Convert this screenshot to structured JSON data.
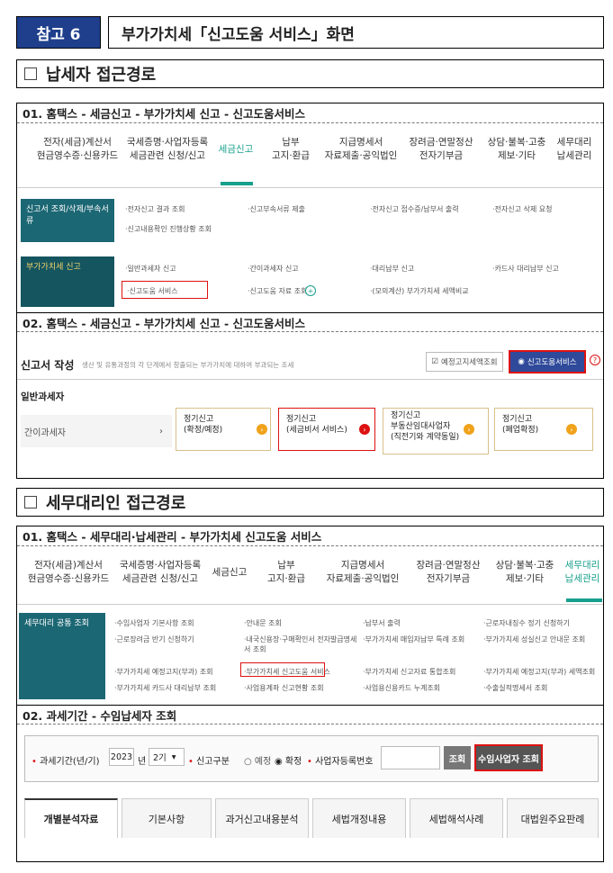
{
  "header": {
    "tag": "참고 6",
    "title": "부가가치세「신고도움 서비스」화면"
  },
  "sec1": {
    "title": "납세자 접근경로",
    "step1": "01. 홈택스 - 세금신고 - 부가가치세 신고 - 신고도움서비스",
    "nav": [
      {
        "l1": "전자(세금)계산서",
        "l2": "현금영수증·신용카드"
      },
      {
        "l1": "국세증명·사업자등록",
        "l2": "세금관련 신청/신고"
      },
      {
        "l1": "세금신고",
        "l2": ""
      },
      {
        "l1": "납부",
        "l2": "고지·환급"
      },
      {
        "l1": "지급명세서",
        "l2": "자료제출·공익법인"
      },
      {
        "l1": "장려금·연말정산",
        "l2": "전자기부금"
      },
      {
        "l1": "상담·불복·고충",
        "l2": "제보·기타"
      },
      {
        "l1": "세무대리",
        "l2": "납세관리"
      }
    ],
    "row1_label": "신고서 조회/삭제/부속서류",
    "row1_items": [
      "·전자신고 결과 조회",
      "·신고부속서류 제출",
      "·전자신고 접수증/납부서 출력",
      "·전자신고 삭제 요청",
      "·신고내용확인 진행상황 조회"
    ],
    "row2_label": "부가가치세 신고",
    "row2_items": [
      "·일반과세자 신고",
      "·간이과세자 신고",
      "·대리납부 신고",
      "·카드사 대리납부 신고",
      "·신고도움 서비스",
      "·신고도움 자료 조회",
      "·(모의계산) 부가가치세 세액비교"
    ],
    "step2": "02. 홈택스 - 세금신고 - 부가가치세 신고 - 신고도움서비스",
    "form_title": "신고서 작성",
    "form_desc": "생산 및 유통과정의 각 단계에서 창출되는 부가가치에 대하여 부과되는 조세",
    "btn_estimate": "예정고지세액조회",
    "btn_help": "신고도움서비스",
    "left_general": "일반과세자",
    "left_simple": "간이과세자",
    "cards": [
      {
        "l1": "정기신고",
        "l2": "(확정/예정)",
        "l3": ""
      },
      {
        "l1": "정기신고",
        "l2": "(세금비서 서비스)",
        "l3": ""
      },
      {
        "l1": "정기신고",
        "l2": "부동산임대사업자",
        "l3": "(직전기와 계약동일)"
      },
      {
        "l1": "정기신고",
        "l2": "(폐업확정)",
        "l3": ""
      }
    ]
  },
  "sec2": {
    "title": "세무대리인 접근경로",
    "step1": "01. 홈택스 - 세무대리·납세관리 - 부가가치세 신고도움 서비스",
    "nav": [
      {
        "l1": "전자(세금)계산서",
        "l2": "현금영수증·신용카드"
      },
      {
        "l1": "국세증명·사업자등록",
        "l2": "세금관련 신청/신고"
      },
      {
        "l1": "세금신고",
        "l2": ""
      },
      {
        "l1": "납부",
        "l2": "고지·환급"
      },
      {
        "l1": "지급명세서",
        "l2": "자료제출·공익법인"
      },
      {
        "l1": "장려금·연말정산",
        "l2": "전자기부금"
      },
      {
        "l1": "상담·불복·고충",
        "l2": "제보·기타"
      },
      {
        "l1": "세무대리",
        "l2": "납세관리"
      }
    ],
    "label": "세무대리 공통 조회",
    "items": [
      "·수임사업자 기본사항 조회",
      "·안내문 조회",
      "·납부서 출력",
      "·근로자내징수 정기 신청하기",
      "·근로장려금 반기 신청하기",
      "·내국신용장·구매확인서 전자발급명세서 조회",
      "·부가가치세 매입자납부 특례 조회",
      "·부가가치세 성실신고 안내문 조회",
      "·부가가치세 예정고지(부과) 조회",
      "·부가가치세 신고도움 서비스",
      "·부가가치세 신고자료 통합조회",
      "·부가가치세 예정고지(부과) 세액조회",
      "·부가가치세 카드사 대리납부 조회",
      "·사업용계좌 신고현황 조회",
      "·사업용신용카드 누계조회",
      "·수출실적명세서 조회"
    ],
    "step2": "02. 과세기간 - 수임납세자 조회",
    "q_period": "과세기간(년/기)",
    "q_year": "2023",
    "q_year_unit": "년",
    "q_term": "2기",
    "q_type": "신고구분",
    "q_opt1": "예정",
    "q_opt2": "확정",
    "q_bizno": "사업자등록번호",
    "q_search": "조회",
    "q_clients": "수임사업자 조회",
    "tabs": [
      "개별분석자료",
      "기본사항",
      "과거신고내용분석",
      "세법개정내용",
      "세법해석사례",
      "대법원주요판례"
    ]
  }
}
